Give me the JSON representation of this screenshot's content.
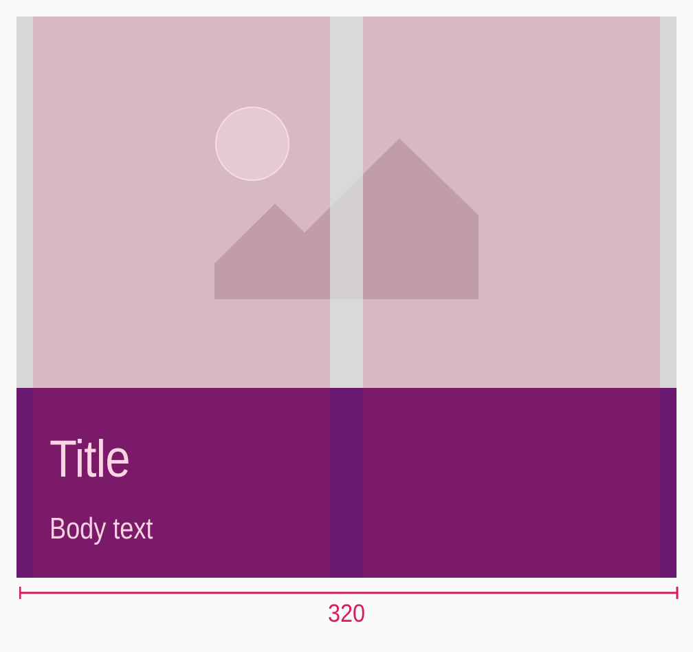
{
  "card": {
    "title": "Title",
    "body": "Body text"
  },
  "measurement": {
    "width_label": "320"
  },
  "icons": {
    "media_placeholder": "image-placeholder-icon"
  },
  "colors": {
    "background": "#fafafa",
    "grid_margin": "#d8d8d8",
    "media_column": "#d8b9c3",
    "text_area_gutter": "#6a1b70",
    "text_area_column": "#7b1a69",
    "title_text": "#fad6e4",
    "measure_accent": "#d81b60"
  }
}
